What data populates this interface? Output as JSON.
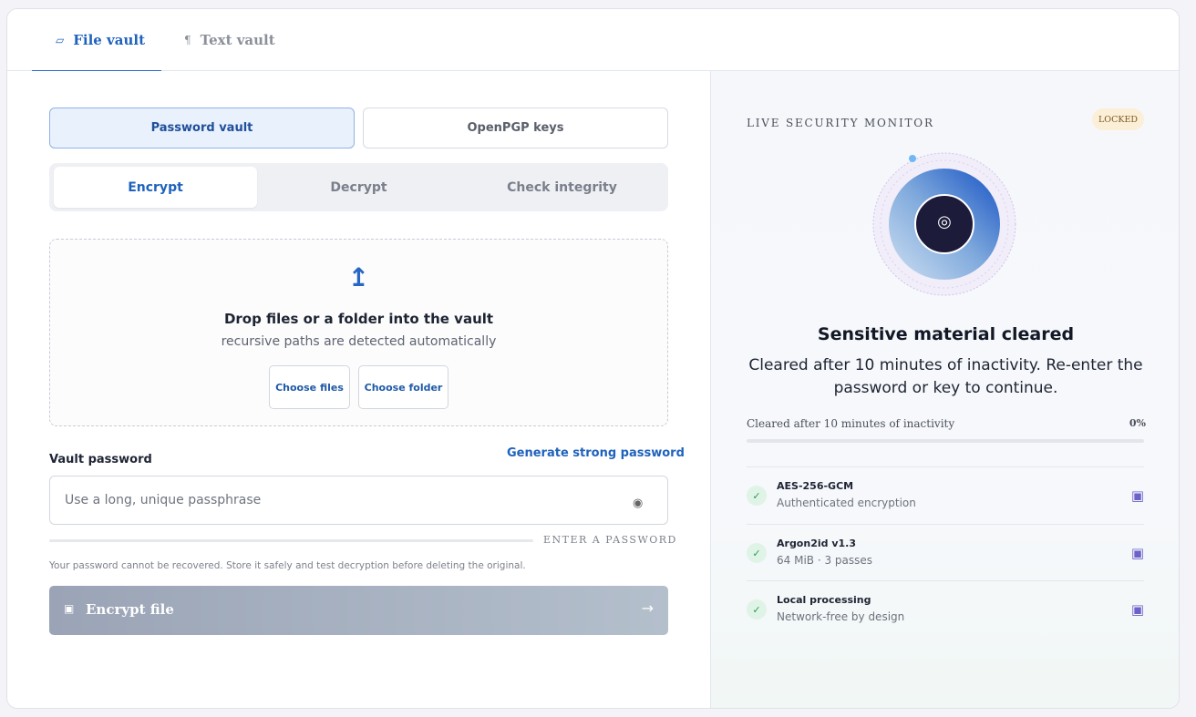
{
  "tabs": [
    {
      "label": "File vault",
      "icon": "▱"
    },
    {
      "label": "Text vault",
      "icon": "¶"
    }
  ],
  "mode": {
    "password": "Password vault",
    "pgp": "OpenPGP keys"
  },
  "segments": [
    "Encrypt",
    "Decrypt",
    "Check integrity"
  ],
  "drop": {
    "icon": "↥",
    "title": "Drop files or a folder into the vault",
    "subtitle": "recursive paths are detected automatically",
    "choose_files": "Choose files",
    "choose_folder": "Choose folder"
  },
  "password": {
    "label": "Vault password",
    "generate": "Generate strong password",
    "placeholder": "Use a long, unique passphrase",
    "strength": "ENTER A PASSWORD",
    "note": "Your password cannot be recovered. Store it safely and test decryption before deleting the original.",
    "eye_icon": "◉"
  },
  "encrypt_button": {
    "icon": "▣",
    "label": "Encrypt file",
    "arrow": "→"
  },
  "monitor": {
    "title": "LIVE SECURITY MONITOR",
    "badge": "LOCKED",
    "center_icon": "◎",
    "status_title": "Sensitive material cleared",
    "status_desc": "Cleared after 10 minutes of inactivity. Re-enter the password or key to continue.",
    "progress_label": "Cleared after 10 minutes of inactivity",
    "progress_value": "0%",
    "progress_fraction": 0
  },
  "features": [
    {
      "name": "AES-256-GCM",
      "sub": "Authenticated encryption",
      "check": "✓",
      "chip": "▣"
    },
    {
      "name": "Argon2id v1.3",
      "sub": "64 MiB · 3 passes",
      "check": "✓",
      "chip": "▣"
    },
    {
      "name": "Local processing",
      "sub": "Network-free by design",
      "check": "✓",
      "chip": "▣"
    }
  ],
  "colors": {
    "accent": "#2a6bc7",
    "badge_bg": "#fcefd8",
    "check_bg": "#dff4e6"
  }
}
